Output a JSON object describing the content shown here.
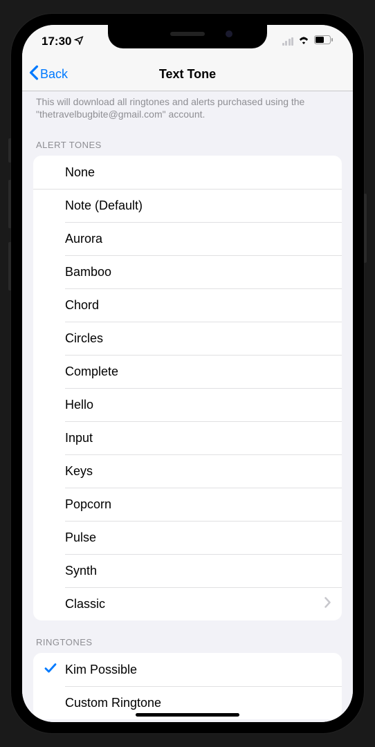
{
  "statusBar": {
    "time": "17:30"
  },
  "navBar": {
    "backLabel": "Back",
    "title": "Text Tone"
  },
  "description": "This will download all ringtones and alerts purchased using the \"thetravelbugbite@gmail.com\" account.",
  "sections": {
    "alertTones": {
      "header": "Alert Tones",
      "none": "None",
      "items": [
        "Note (Default)",
        "Aurora",
        "Bamboo",
        "Chord",
        "Circles",
        "Complete",
        "Hello",
        "Input",
        "Keys",
        "Popcorn",
        "Pulse",
        "Synth"
      ],
      "classic": "Classic"
    },
    "ringtones": {
      "header": "Ringtones",
      "items": [
        {
          "label": "Kim Possible",
          "selected": true
        },
        {
          "label": "Custom Ringtone",
          "selected": false
        }
      ]
    }
  }
}
